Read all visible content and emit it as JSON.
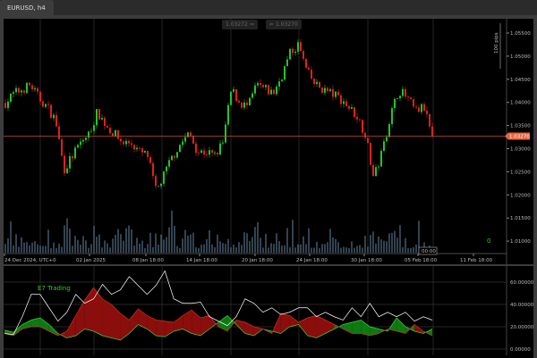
{
  "window": {
    "tab_title": "EURUSD, h4"
  },
  "quotes": {
    "bid": "1.03272",
    "bid_arrow": "⇒",
    "ask_arrow": "⇐",
    "ask": "1.03270"
  },
  "ruler": {
    "label": "100 pips"
  },
  "price_axis": {
    "labels": [
      "1.05500",
      "1.05000",
      "1.04500",
      "1.04000",
      "1.03500",
      "1.03000",
      "1.02500",
      "1.02000",
      "1.01500",
      "1.01000"
    ],
    "current": "1.03270"
  },
  "volume_counter": "0",
  "timer": "00:00",
  "time_axis": {
    "labels": [
      "24 Dec 2024, UTC+0",
      "02 Jan 2025",
      "08 Jan 18:00",
      "14 Jan 18:00",
      "20 Jan 18:00",
      "24 Jan 18:00",
      "30 Jan 18:00",
      "05 Feb 18:00",
      "11 Feb 18:00"
    ]
  },
  "indicator": {
    "name": "E7 Trading",
    "levels": [
      "60.00000",
      "40.00000",
      "20.00000",
      "0.00000"
    ]
  },
  "colors": {
    "bull": "#22c42a",
    "bear": "#e0201c",
    "volume": "#7fa8c8",
    "price_line": "#c0502c",
    "current_badge": "#e8643a",
    "indicator_name": "#2fc83a",
    "white_line": "#ffffff"
  },
  "chart_data": [
    {
      "type": "candlestick",
      "symbol": "EURUSD",
      "timeframe": "h4",
      "ylim": [
        1.01,
        1.056
      ],
      "close_path": [
        1.0399,
        1.0419,
        1.0428,
        1.0438,
        1.0409,
        1.039,
        1.0361,
        1.0255,
        1.0284,
        1.0313,
        1.0332,
        1.038,
        1.0351,
        1.0332,
        1.0313,
        1.0313,
        1.0293,
        1.0284,
        1.0206,
        1.0245,
        1.0284,
        1.0313,
        1.0332,
        1.0293,
        1.0293,
        1.0284,
        1.0313,
        1.0428,
        1.0399,
        1.039,
        1.0438,
        1.0428,
        1.0419,
        1.0457,
        1.0506,
        1.0525,
        1.0467,
        1.0438,
        1.0428,
        1.0419,
        1.0409,
        1.039,
        1.0371,
        1.0332,
        1.0235,
        1.0293,
        1.0371,
        1.0428,
        1.0409,
        1.038,
        1.039,
        1.0327
      ],
      "last_price": 1.0327
    },
    {
      "type": "line",
      "name": "E7 Trading",
      "ylim": [
        0,
        70
      ],
      "white": [
        14,
        13,
        29,
        49,
        49,
        37,
        25,
        33,
        49,
        41,
        45,
        58,
        49,
        53,
        65,
        57,
        49,
        57,
        70,
        45,
        41,
        41,
        42,
        29,
        25,
        21,
        29,
        45,
        41,
        33,
        37,
        31,
        33,
        37,
        37,
        29,
        33,
        29,
        26,
        37,
        29,
        41,
        29,
        33,
        29,
        33,
        25,
        29,
        26
      ],
      "green": [
        17,
        15,
        22,
        26,
        28,
        22,
        14,
        10,
        12,
        18,
        16,
        12,
        10,
        8,
        14,
        22,
        18,
        12,
        11,
        16,
        18,
        14,
        12,
        18,
        24,
        30,
        22,
        14,
        12,
        18,
        16,
        14,
        20,
        22,
        12,
        10,
        14,
        18,
        22,
        24,
        26,
        20,
        18,
        16,
        28,
        20,
        16,
        14,
        18
      ],
      "red": [
        14,
        12,
        18,
        20,
        20,
        16,
        12,
        16,
        30,
        44,
        55,
        45,
        40,
        32,
        26,
        36,
        30,
        26,
        25,
        24,
        30,
        35,
        28,
        30,
        20,
        16,
        26,
        24,
        20,
        18,
        14,
        32,
        30,
        24,
        28,
        30,
        26,
        22,
        18,
        14,
        14,
        12,
        14,
        18,
        16,
        14,
        22,
        16,
        12
      ]
    }
  ]
}
